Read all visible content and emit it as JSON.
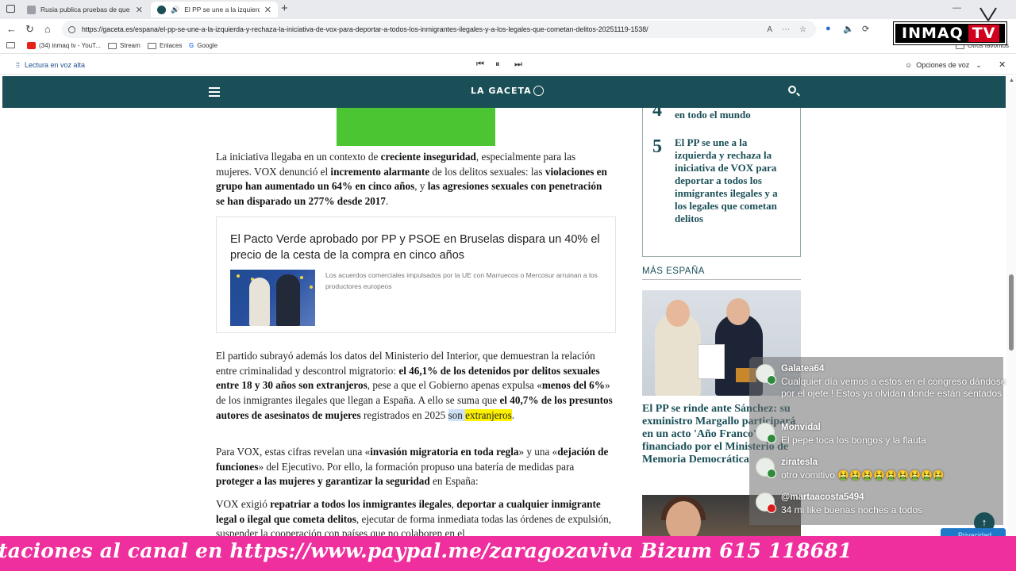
{
  "browser": {
    "tabs": [
      {
        "title": "Rusia publica pruebas de que avi",
        "active": false
      },
      {
        "title": "El PP se une a la izquierda y",
        "active": true
      }
    ],
    "url": "https://gaceta.es/espana/el-pp-se-une-a-la-izquierda-y-rechaza-la-iniciativa-de-vox-para-deportar-a-todos-los-inmigrantes-ilegales-y-a-los-legales-que-cometan-delitos-20251119-1538/",
    "bookmarks": [
      "(34) inmaq tv - YouT...",
      "Stream",
      "Enlaces",
      "Google"
    ],
    "other_bookmarks": "Otros favoritos",
    "read_aloud": {
      "label": "Lectura en voz alta",
      "voice_options": "Opciones de voz"
    }
  },
  "overlay_logo": {
    "text": "INMAQ",
    "badge": "TV"
  },
  "site": {
    "brand": "LA GACETA"
  },
  "article": {
    "p1": {
      "s1": "La iniciativa llegaba en un contexto de ",
      "b1": "creciente inseguridad",
      "s2": ", especialmente para las mujeres. VOX denunció el ",
      "b2": "incremento alarmante",
      "s3": " de los delitos sexuales: las ",
      "b3": "violaciones en grupo han aumentado un 64% en cinco años",
      "s4": ", y ",
      "b4": "las agresiones sexuales con penetración se han disparado un 277% desde 2017",
      "s5": "."
    },
    "related": {
      "title": "El Pacto Verde aprobado por PP y PSOE en Bruselas dispara un 40% el precio de la cesta de la compra en cinco años",
      "summary": "Los acuerdos comerciales impulsados por la UE con Marruecos o Mercosur arruinan a los productores europeos"
    },
    "p2": {
      "s1": "El partido subrayó además los datos del Ministerio del Interior, que demuestran la relación entre criminalidad y descontrol migratorio: ",
      "b1": "el 46,1% de los detenidos por delitos sexuales entre 18 y 30 años son extranjeros",
      "s2": ", pese a que el Gobierno apenas expulsa «",
      "b2": "menos del 6%",
      "s3": "» de los inmigrantes ilegales que llegan a España. A ello se suma que ",
      "b3": "el 40,7% de los presuntos autores de asesinatos de mujeres",
      "s4": " registrados en 2025 ",
      "sel": "son",
      "sp": " ",
      "yel": "extranjeros",
      "s5": "."
    },
    "p3": {
      "s1": "Para VOX, estas cifras revelan una «",
      "b1": "invasión migratoria en toda regla",
      "s2": "» y una «",
      "b2": "dejación de funciones",
      "s3": "» del Ejecutivo. Por ello, la formación propuso una batería de medidas para ",
      "b3": "proteger a las mujeres y garantizar la seguridad",
      "s4": " en España:"
    },
    "p4": {
      "s1": "VOX exigió ",
      "b1": "repatriar a todos los inmigrantes ilegales",
      "s2": ", ",
      "b2": "deportar a cualquier inmigrante legal o ilegal que cometa delitos",
      "s3": ", ejecutar de forma inmediata todas las órdenes de expulsión, suspender la cooperación con países que no colaboren en el"
    }
  },
  "sidebar": {
    "item4": {
      "number": "4",
      "text": "en todo el mundo"
    },
    "item5": {
      "number": "5",
      "text": "El PP se une a la izquierda y rechaza la iniciativa de VOX para deportar a todos los inmigrantes ilegales y a los legales que cometan delitos"
    },
    "section_title": "MÁS ESPAÑA",
    "story1_title": "El PP se rinde ante Sánchez: su exministro Margallo participará en un acto 'Año Franco' financiado por el Ministerio de Memoria Democrática"
  },
  "chat": [
    {
      "user": "Galatea64",
      "text": "Cualquier día vemos a estos en el congreso dándose por el ojete ! Estos ya olvidan donde están sentados"
    },
    {
      "user": "Monvidal",
      "text": "El pepe toca los bongos y la flauta"
    },
    {
      "user": "ziratesla",
      "text": "otro vomitivo 🤮🤮🤮🤮🤮🤮🤮🤮🤮"
    },
    {
      "user": "@martaacosta5494",
      "text": "34 mi like buenas noches a todos"
    }
  ],
  "privacy_label": "Privacidad",
  "ticker": "taciones al canal en https://www.paypal.me/zaragozaviva Bizum 615 118681",
  "colors": {
    "header": "#1a4f57",
    "ad": "#4bc531",
    "ticker": "#ee2f9d",
    "logo_badge": "#d1001c"
  }
}
